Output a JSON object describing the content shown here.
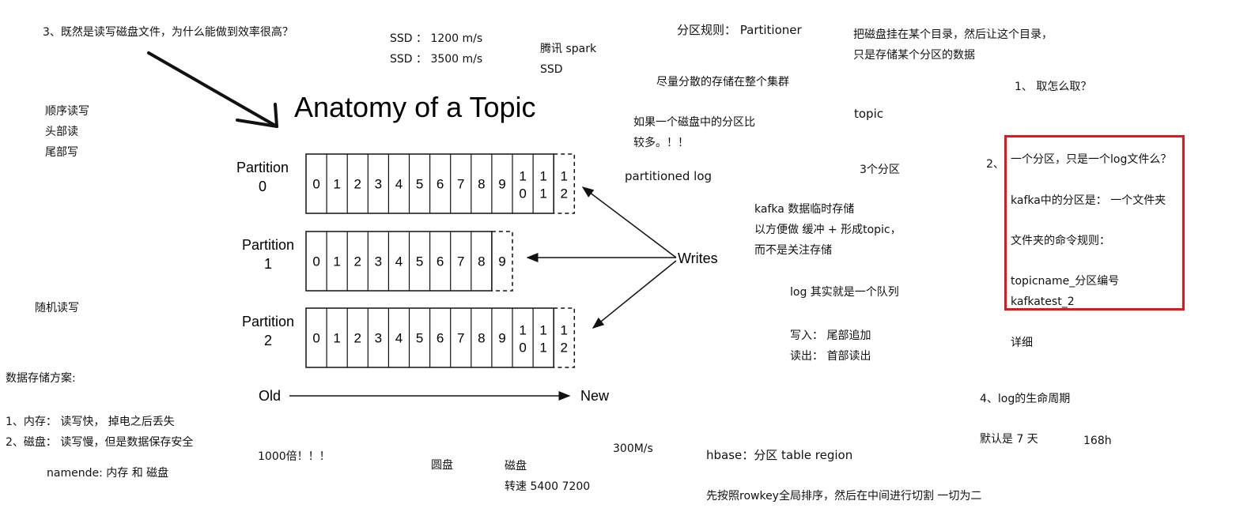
{
  "diagram": {
    "title": "Anatomy of a Topic",
    "partitions": [
      {
        "label": "Partition",
        "index": "0",
        "cells": [
          "0",
          "1",
          "2",
          "3",
          "4",
          "5",
          "6",
          "7",
          "8",
          "9",
          "1\n0",
          "1\n1",
          "1\n2"
        ],
        "open_cell": "1\n2"
      },
      {
        "label": "Partition",
        "index": "1",
        "cells": [
          "0",
          "1",
          "2",
          "3",
          "4",
          "5",
          "6",
          "7",
          "8",
          "9"
        ],
        "open_cell": "9"
      },
      {
        "label": "Partition",
        "index": "2",
        "cells": [
          "0",
          "1",
          "2",
          "3",
          "4",
          "5",
          "6",
          "7",
          "8",
          "9",
          "1\n0",
          "1\n1",
          "1\n2"
        ],
        "open_cell": "1\n2"
      }
    ],
    "writes_label": "Writes",
    "old_label": "Old",
    "new_label": "New"
  },
  "notes": {
    "question3": "3、既然是读写磁盘文件，为什么能做到效率很高？",
    "seq_rw": [
      "顺序读写",
      "头部读",
      "尾部写"
    ],
    "random_rw": "随机读写",
    "storage_plan_title": "数据存储方案:",
    "storage_plan": [
      "1、内存： 读写快，  掉电之后丢失",
      "2、磁盘： 读写慢，但是数据保存安全"
    ],
    "namenode": "namende:  内存 和 磁盘",
    "ssd": [
      "SSD  ：  1200     m/s",
      "SSD   ：  3500  m/s"
    ],
    "tencent": [
      "腾讯 spark",
      "SSD"
    ],
    "partitioner": "分区规则： Partitioner",
    "spread": "尽量分散的存储在整个集群",
    "disk_many": [
      "如果一个磁盘中的分区比",
      "较多。！！"
    ],
    "partitioned_log": "partitioned log",
    "mount": [
      "把磁盘挂在某个目录，然后让这个目录，",
      "只是存储某个分区的数据"
    ],
    "topic": "topic",
    "three_partitions": "3个分区",
    "kafka_temp": [
      "kafka 数据临时存储",
      "以方便做  缓冲 + 形成topic，",
      "而不是关注存储"
    ],
    "log_queue": "log 其实就是一个队列",
    "write_read": [
      "写入：   尾部追加",
      "读出：   首部读出"
    ],
    "q1": "1、     取怎么取？",
    "q2_num": "2、",
    "q2_box": [
      "一个分区，只是一个log文件么？",
      "kafka中的分区是： 一个文件夹",
      "文件夹的命令规则：",
      "topicname_分区编号",
      "kafkatest_2"
    ],
    "detail": "详细",
    "q4": "4、log的生命周期",
    "default_days": "默认是  7 天",
    "hours": "168h",
    "thousand": "1000倍！！！",
    "disk_round": "圆盘",
    "disk_speed": [
      "磁盘",
      "转速  5400  7200"
    ],
    "speed300": "300M/s",
    "hbase": "hbase：分区    table   region",
    "rowkey": "先按照rowkey全局排序，然后在中间进行切割   一切为二"
  }
}
